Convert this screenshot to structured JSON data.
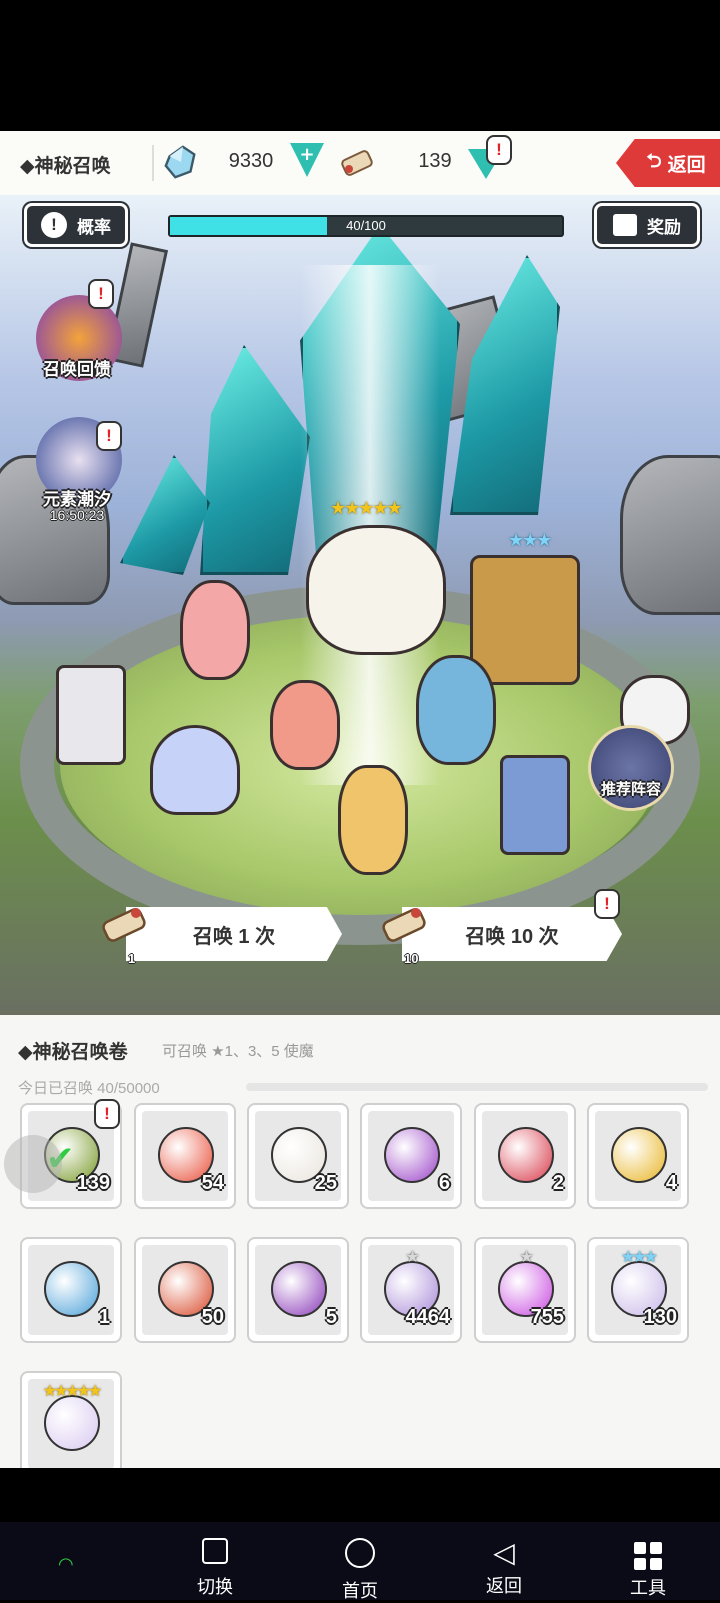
{
  "header": {
    "title": "◆神秘召唤",
    "gem_count": "9330",
    "scroll_count": "139",
    "back_label": "返回"
  },
  "scene": {
    "rate_label": "概率",
    "reward_label": "奖励",
    "progress_text": "40/100",
    "progress_fraction": 0.4,
    "side": {
      "feedback_label": "召唤回馈",
      "tide_label": "元素潮汐",
      "tide_timer": "16:50:23"
    },
    "recommend_label": "推荐阵容",
    "summon_once": {
      "label": "召唤 1 次",
      "cost": "1"
    },
    "summon_ten": {
      "label": "召唤 10 次",
      "cost": "10"
    }
  },
  "panel": {
    "title": "◆神秘召唤卷",
    "note": "可召唤 ★1、3、5 使魔",
    "today": "今日已召唤 40/50000",
    "items": [
      {
        "name": "mystic-summon-scroll",
        "count": "139",
        "color": "#7a9a2a"
      },
      {
        "name": "heart",
        "count": "54",
        "color": "#e8503a"
      },
      {
        "name": "letter-scroll",
        "count": "25",
        "color": "#e9e4dc"
      },
      {
        "name": "purple-scroll",
        "count": "6",
        "color": "#9b45c8"
      },
      {
        "name": "red-scroll",
        "count": "2",
        "color": "#d83a4a"
      },
      {
        "name": "gold-scroll",
        "count": "4",
        "color": "#e8b526"
      },
      {
        "name": "blue-scroll",
        "count": "1",
        "color": "#4aa0d8"
      },
      {
        "name": "red-gold-scroll",
        "count": "50",
        "color": "#d8492a"
      },
      {
        "name": "violet-gold-scroll",
        "count": "5",
        "color": "#8a3ab8"
      },
      {
        "name": "crystal-shard-1star",
        "count": "4464",
        "color": "#a88ad8",
        "stars": "★"
      },
      {
        "name": "crystal-shard-purple-1star",
        "count": "755",
        "color": "#c94ae0",
        "stars": "★"
      },
      {
        "name": "orb-3star",
        "count": "130",
        "color": "#c8b8e8",
        "stars": "★★★"
      },
      {
        "name": "orb-5star",
        "count": "",
        "color": "#d8c8f0",
        "stars": "★★★★★"
      }
    ]
  },
  "nav": {
    "switch": "切换",
    "home": "首页",
    "back": "返回",
    "tools": "工具"
  }
}
